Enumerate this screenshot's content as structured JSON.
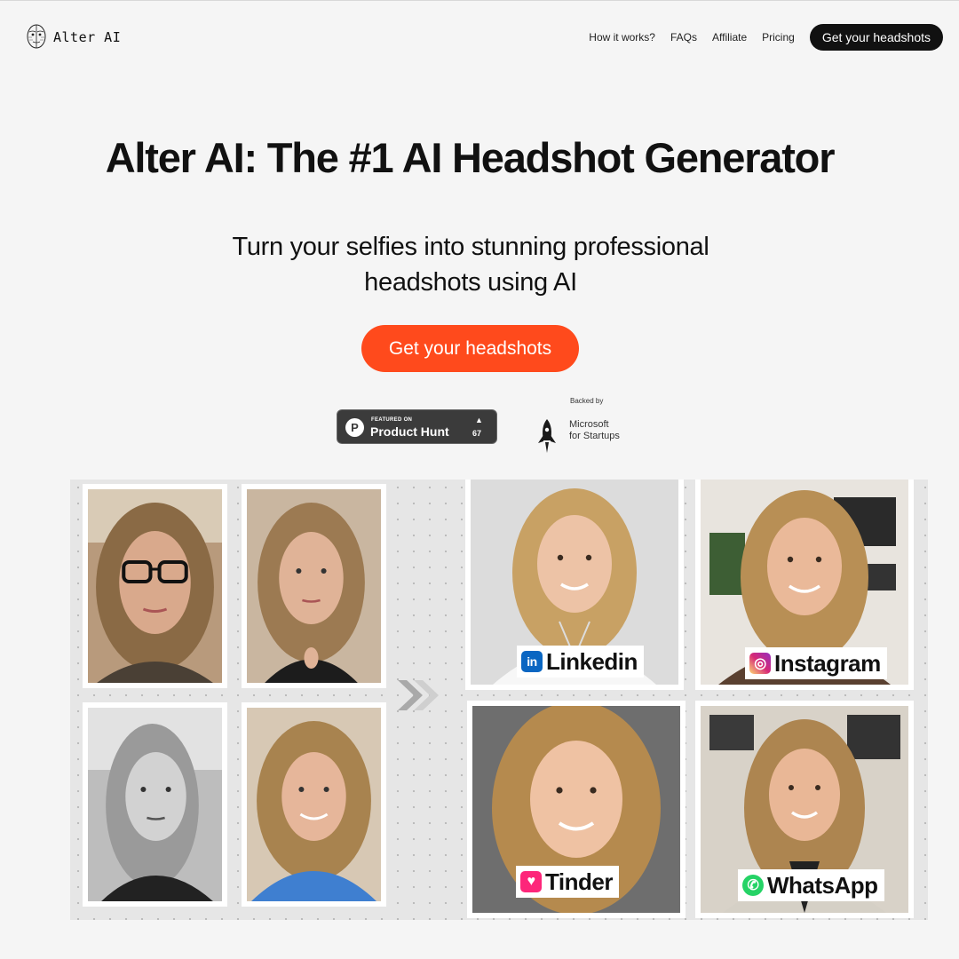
{
  "nav": {
    "logo_text": "Alter AI",
    "links": [
      "How it works?",
      "FAQs",
      "Affiliate",
      "Pricing"
    ],
    "cta": "Get your headshots"
  },
  "hero": {
    "title": "Alter AI: The #1 AI Headshot Generator",
    "subtitle_line1": "Turn your selfies into stunning professional",
    "subtitle_line2": "headshots using AI",
    "cta": "Get your headshots"
  },
  "badges": {
    "producthunt": {
      "featured": "FEATURED ON",
      "name": "Product Hunt",
      "votes": "67",
      "arrow": "▲"
    },
    "microsoft": {
      "backed": "Backed by",
      "line1": "Microsoft",
      "line2": "for Startups"
    }
  },
  "gallery": {
    "selfies": [
      "selfie-1",
      "selfie-2",
      "selfie-3",
      "selfie-4"
    ],
    "results": [
      {
        "platform": "Linkedin",
        "icon": "linkedin-icon",
        "color": "#0a66c2",
        "glyph": "in"
      },
      {
        "platform": "Instagram",
        "icon": "instagram-icon",
        "color": "#d6249f",
        "glyph": "◎"
      },
      {
        "platform": "Tinder",
        "icon": "tinder-icon",
        "color": "#fd267a",
        "glyph": "♥"
      },
      {
        "platform": "WhatsApp",
        "icon": "whatsapp-icon",
        "color": "#25d366",
        "glyph": "✆"
      }
    ]
  },
  "colors": {
    "accent": "#ff4a1c",
    "dark": "#111111",
    "background": "#f5f5f5"
  }
}
